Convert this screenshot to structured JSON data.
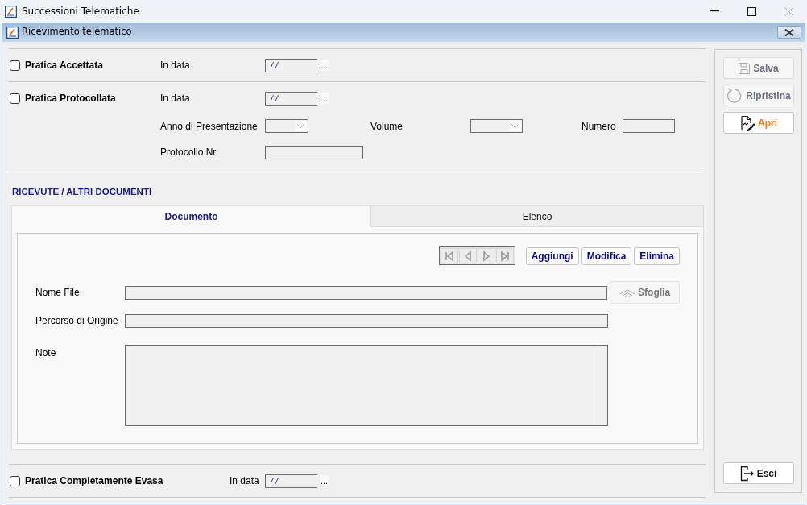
{
  "window": {
    "title": "Successioni Telematiche"
  },
  "dialog": {
    "title": "Ricevimento telematico"
  },
  "pratica_accettata": {
    "label": "Pratica Accettata",
    "checked": false,
    "date_label": "In data",
    "date_value": "/ /",
    "date_button": "..."
  },
  "pratica_protocollata": {
    "label": "Pratica Protocollata",
    "checked": false,
    "date_label": "In data",
    "date_value": "/ /",
    "date_button": "...",
    "anno_label": "Anno di Presentazione",
    "volume_label": "Volume",
    "numero_label": "Numero",
    "protocollo_label": "Protocollo Nr."
  },
  "documenti": {
    "title": "RICEVUTE / ALTRI DOCUMENTI",
    "tabs": [
      {
        "label": "Documento",
        "selected": true
      },
      {
        "label": "Elenco",
        "selected": false
      }
    ],
    "actions": [
      "Aggiungi",
      "Modifica",
      "Elimina"
    ],
    "nome_file_label": "Nome File",
    "browse_button": {
      "label": "Sfoglia",
      "disabled": true
    },
    "percorso_label": "Percorso di Origine",
    "note_label": "Note"
  },
  "pratica_evasa": {
    "label": "Pratica Completamente Evasa",
    "checked": false,
    "date_label": "In data",
    "date_value": "/ /",
    "date_button": "..."
  },
  "side_buttons": [
    {
      "kind": "save",
      "label": "Salva",
      "disabled": true
    },
    {
      "kind": "restore",
      "label": "Ripristina",
      "disabled": true
    },
    {
      "kind": "open",
      "label": "Apri",
      "disabled": false
    }
  ],
  "exit_button": {
    "label": "Esci"
  }
}
